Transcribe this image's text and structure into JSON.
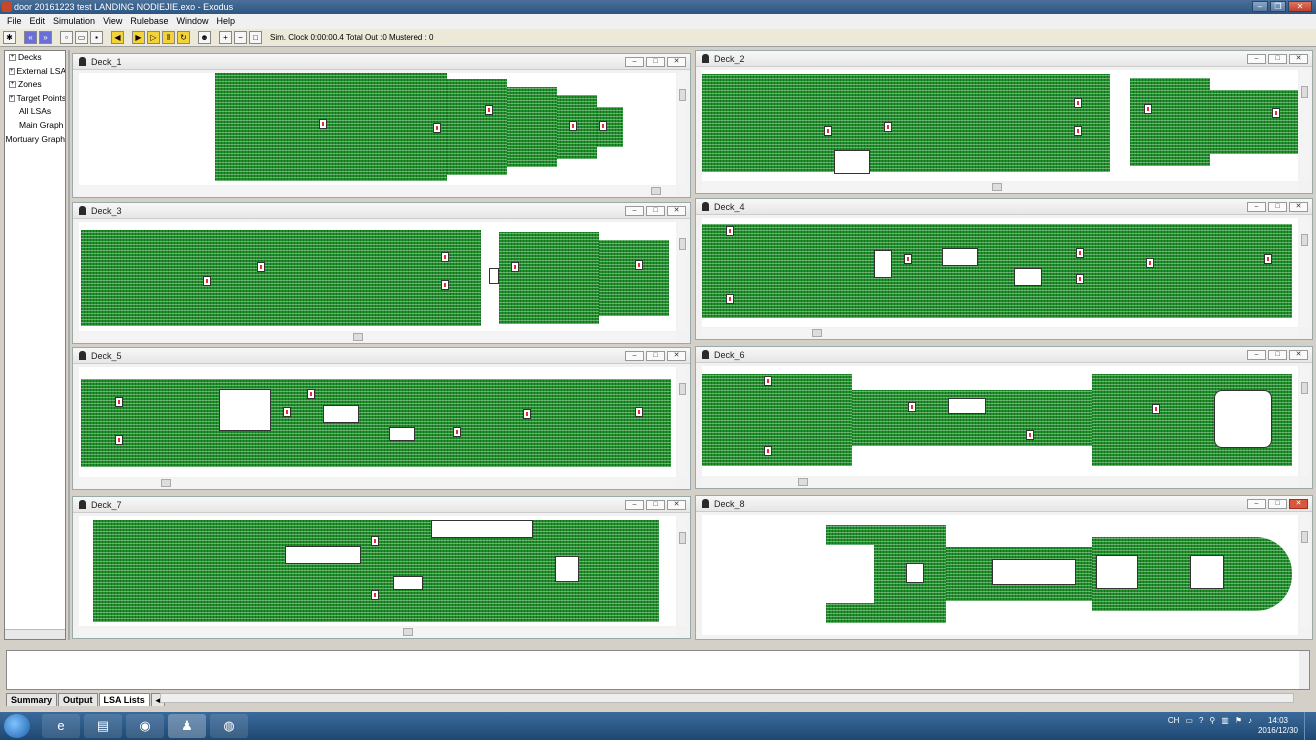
{
  "window": {
    "title": "door 20161223 test LANDING NODIEJIE.exo - Exodus"
  },
  "menu": [
    "File",
    "Edit",
    "Simulation",
    "View",
    "Rulebase",
    "Window",
    "Help"
  ],
  "toolbar": {
    "status": "Sim. Clock  0:00:00.4  Total Out :0   Mustered : 0"
  },
  "tree": [
    {
      "label": "Decks",
      "expandable": true
    },
    {
      "label": "External LSAs",
      "expandable": true
    },
    {
      "label": "Zones",
      "expandable": true
    },
    {
      "label": "Target Points",
      "expandable": true
    },
    {
      "label": "All LSAs",
      "expandable": false
    },
    {
      "label": "Main Graph",
      "expandable": false
    },
    {
      "label": "Mortuary Graph",
      "expandable": false
    }
  ],
  "decks": [
    {
      "name": "Deck_1"
    },
    {
      "name": "Deck_2"
    },
    {
      "name": "Deck_3"
    },
    {
      "name": "Deck_4"
    },
    {
      "name": "Deck_5"
    },
    {
      "name": "Deck_6"
    },
    {
      "name": "Deck_7"
    },
    {
      "name": "Deck_8"
    }
  ],
  "bottom_tabs": [
    "Summary",
    "Output",
    "LSA Lists"
  ],
  "taskbar": {
    "time": "14:03",
    "date": "2016/12/30",
    "ime": "CH"
  },
  "colors": {
    "hull": "#1e8f2a",
    "title": "#2c5682"
  }
}
